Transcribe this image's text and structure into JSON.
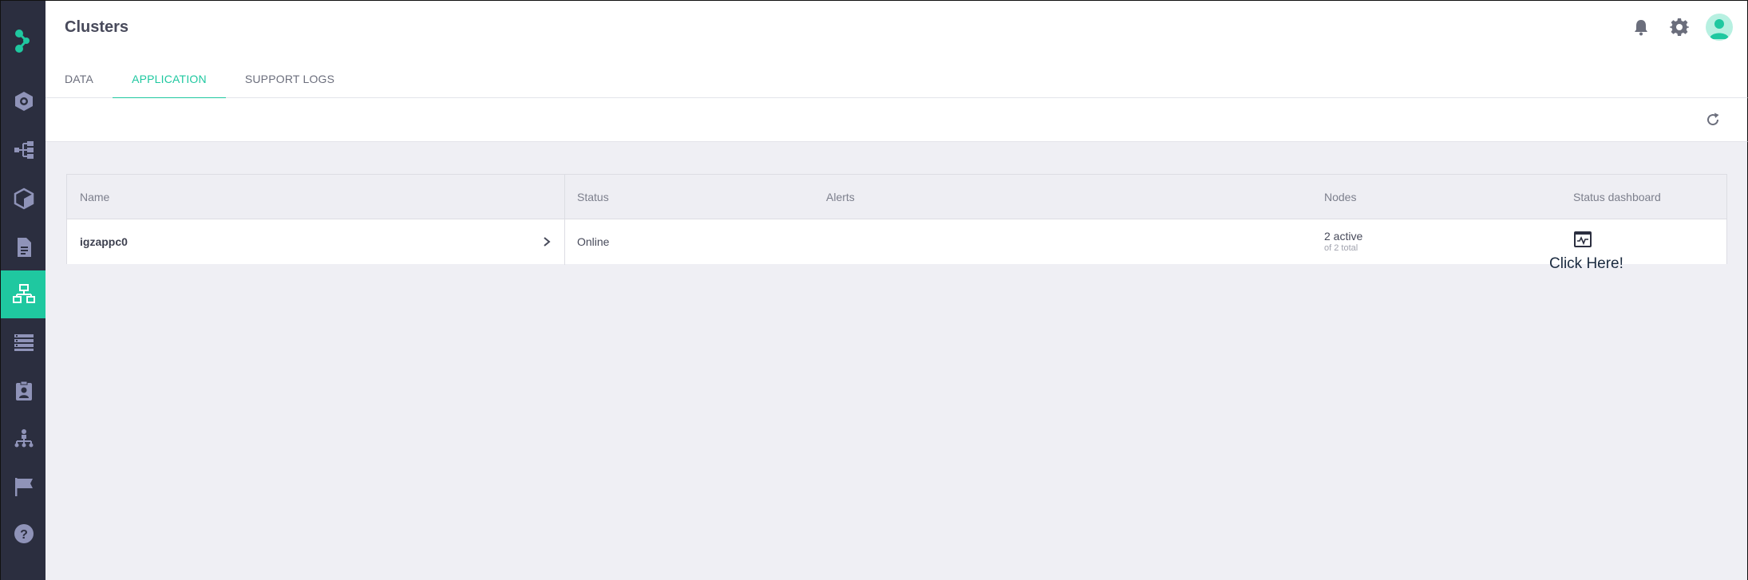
{
  "header": {
    "title": "Clusters",
    "tabs": [
      {
        "label": "DATA",
        "active": false
      },
      {
        "label": "APPLICATION",
        "active": true
      },
      {
        "label": "SUPPORT LOGS",
        "active": false
      }
    ],
    "icons": [
      "bell-icon",
      "gear-icon",
      "user-avatar"
    ]
  },
  "sidebar": {
    "items": [
      {
        "icon": "projects-icon",
        "active": false
      },
      {
        "icon": "pipelines-icon",
        "active": false
      },
      {
        "icon": "containers-icon",
        "active": false
      },
      {
        "icon": "document-icon",
        "active": false
      },
      {
        "icon": "clusters-icon",
        "active": true
      },
      {
        "icon": "storage-list-icon",
        "active": false
      },
      {
        "icon": "identity-icon",
        "active": false
      },
      {
        "icon": "org-chart-icon",
        "active": false
      },
      {
        "icon": "flag-icon",
        "active": false
      },
      {
        "icon": "help-icon",
        "active": false
      }
    ]
  },
  "table": {
    "columns": [
      "Name",
      "Status",
      "Alerts",
      "Nodes",
      "Status dashboard"
    ],
    "rows": [
      {
        "name": "igzappc0",
        "status": "Online",
        "alerts": "",
        "nodes_active": "2 active",
        "nodes_total": "of 2 total"
      }
    ]
  },
  "annotation": {
    "click_here": "Click Here!"
  },
  "colors": {
    "accent": "#1fc8a0",
    "sidebar": "#2b2e3f",
    "sidebar_icon": "#8f93b8"
  }
}
